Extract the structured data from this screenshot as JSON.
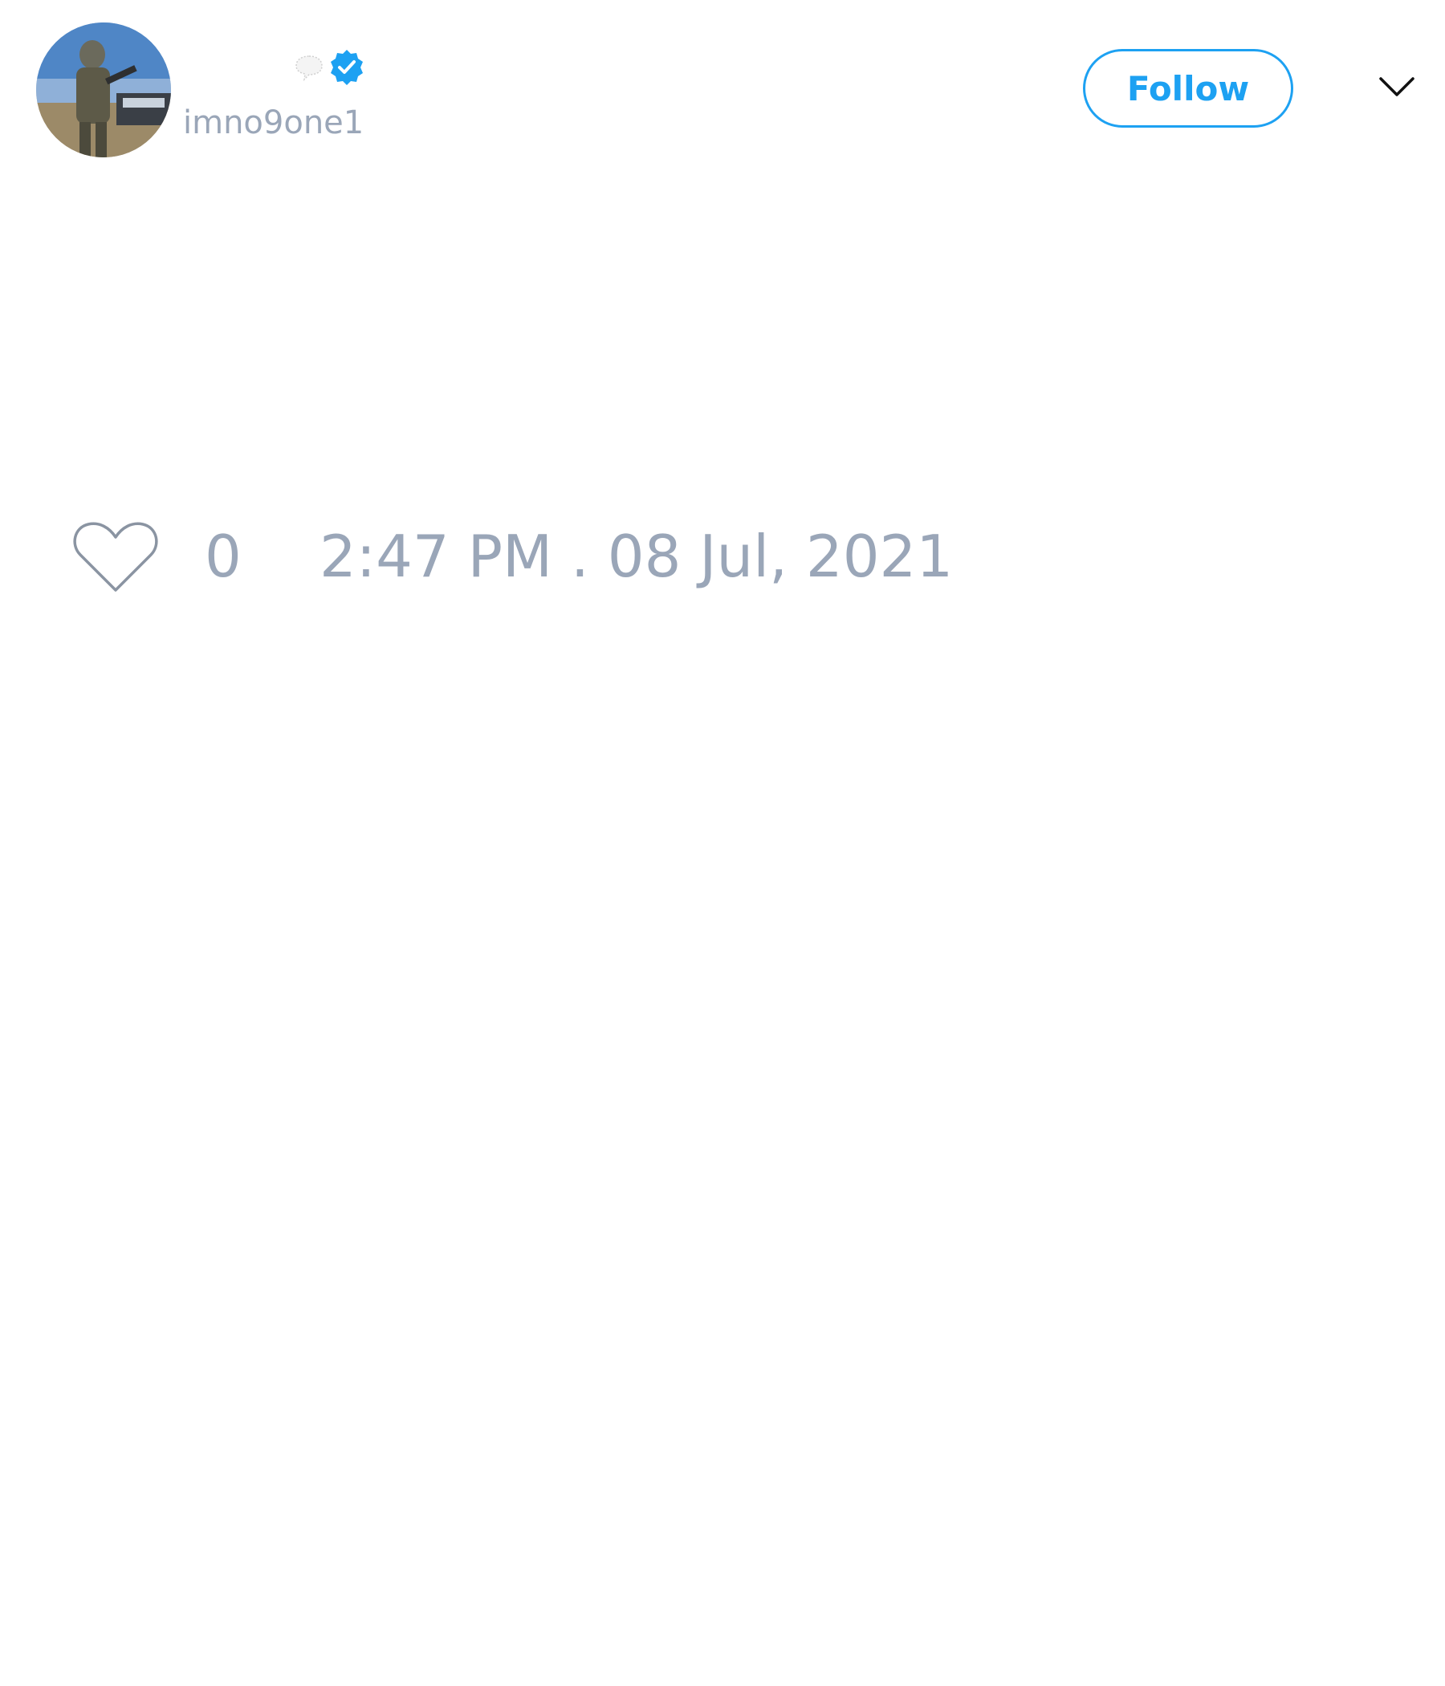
{
  "tweet": {
    "author": {
      "display_name": "",
      "handle": "imno9one1",
      "avatar_icon": "user-avatar-photo",
      "badges": [
        "speech-balloon-icon",
        "verified-icon"
      ]
    },
    "follow_label": "Follow",
    "menu_icon": "chevron-down-icon",
    "likes": {
      "icon": "heart-icon",
      "count": "0"
    },
    "timestamp": "2:47 PM . 08 Jul, 2021"
  },
  "colors": {
    "accent": "#1da1f2",
    "muted_text": "#9aa6b8",
    "background": "#ffffff"
  }
}
